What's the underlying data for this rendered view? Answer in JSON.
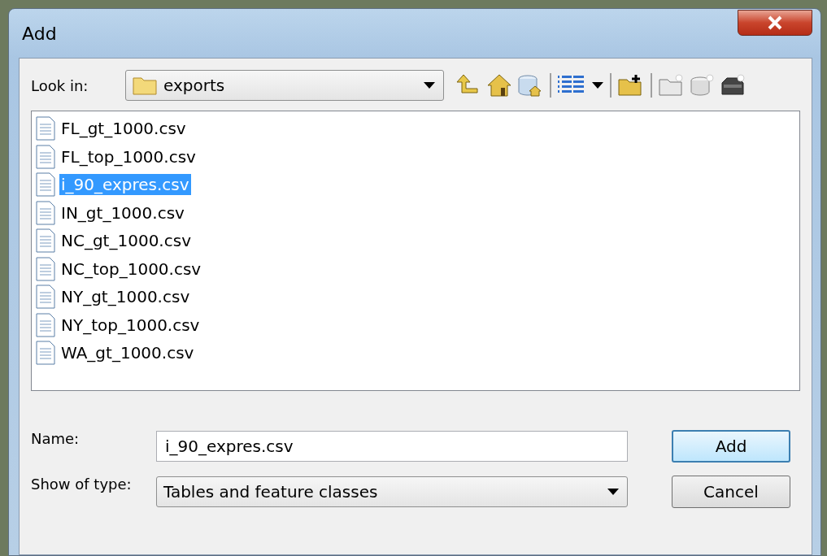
{
  "window": {
    "title": "Add"
  },
  "look_in": {
    "label": "Look in:",
    "value": "exports"
  },
  "files": [
    {
      "name": "FL_gt_1000.csv",
      "selected": false
    },
    {
      "name": "FL_top_1000.csv",
      "selected": false
    },
    {
      "name": "i_90_expres.csv",
      "selected": true
    },
    {
      "name": "IN_gt_1000.csv",
      "selected": false
    },
    {
      "name": "NC_gt_1000.csv",
      "selected": false
    },
    {
      "name": "NC_top_1000.csv",
      "selected": false
    },
    {
      "name": "NY_gt_1000.csv",
      "selected": false
    },
    {
      "name": "NY_top_1000.csv",
      "selected": false
    },
    {
      "name": "WA_gt_1000.csv",
      "selected": false
    }
  ],
  "name_field": {
    "label": "Name:",
    "value": "i_90_expres.csv"
  },
  "type_field": {
    "label": "Show of type:",
    "value": "Tables and feature classes"
  },
  "buttons": [
    {
      "label": "Add",
      "default": true
    },
    {
      "label": "Cancel",
      "default": false
    }
  ]
}
